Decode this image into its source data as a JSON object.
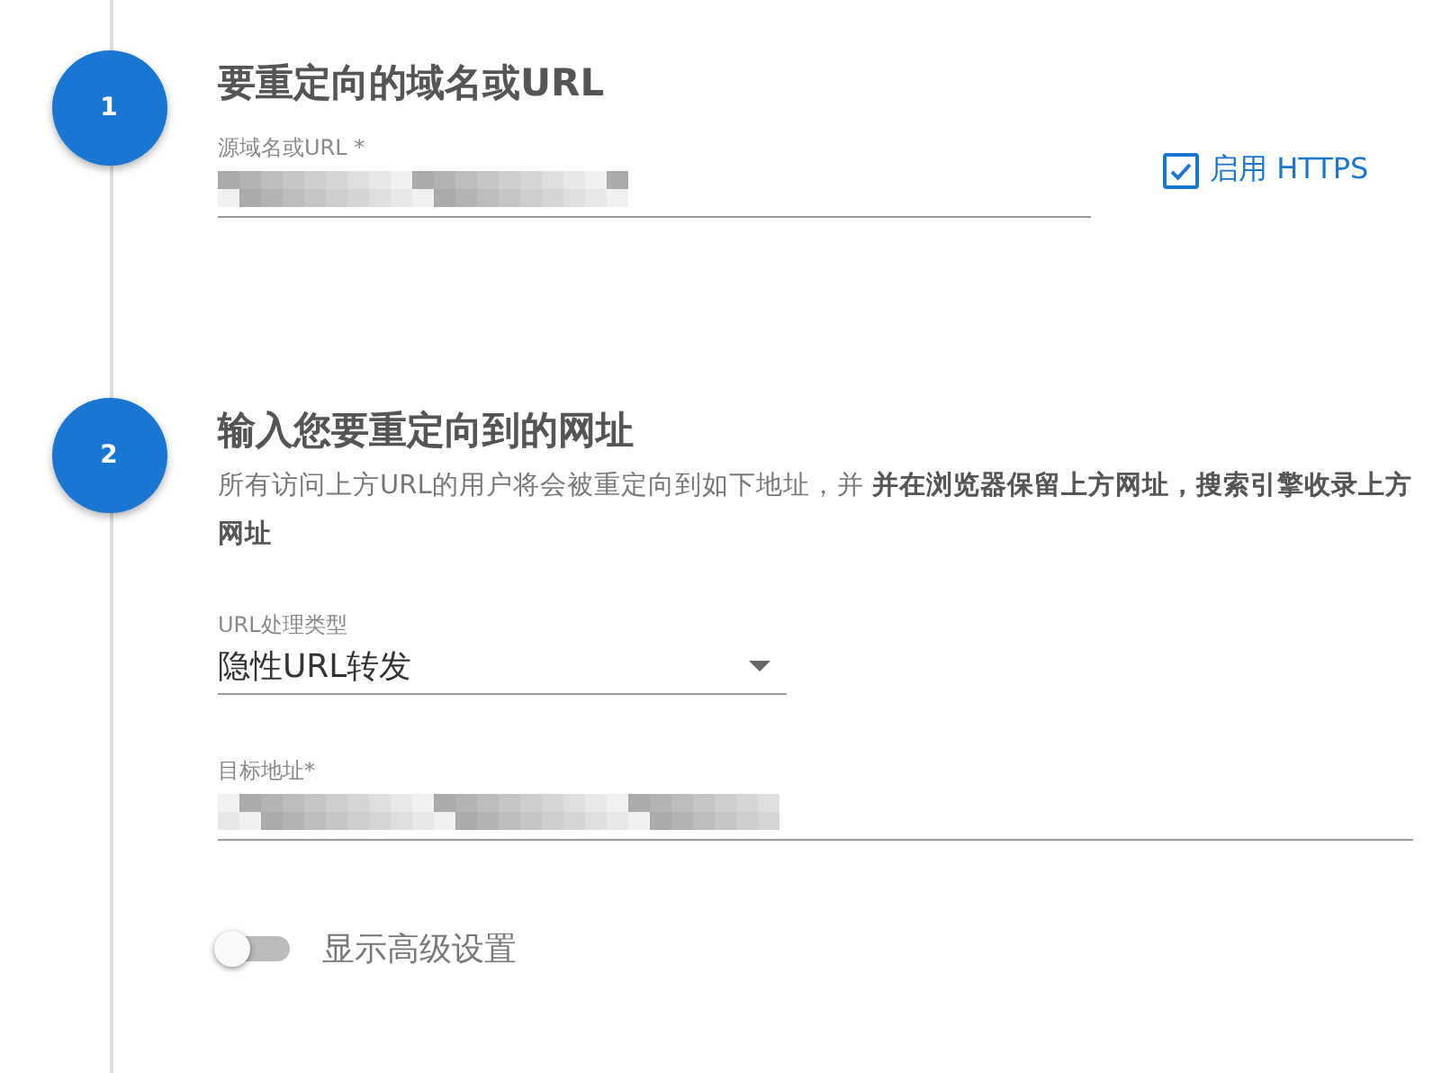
{
  "steps": [
    {
      "number": "1",
      "title": "要重定向的域名或URL",
      "fields": [
        {
          "kind": "text",
          "label": "源域名或URL *",
          "value_redacted": true
        }
      ],
      "https_option": {
        "label": "启用 HTTPS",
        "checked": true
      }
    },
    {
      "number": "2",
      "title": "输入您要重定向到的网址",
      "description": "所有访问上方URL的用户将会被重定向到如下地址，并 **并在浏览器保留上方网址，搜索引擎收录上方网址**",
      "fields": [
        {
          "kind": "select",
          "label": "URL处理类型",
          "value": "隐性URL转发"
        },
        {
          "kind": "text",
          "label": "目标地址*",
          "value_redacted": true
        }
      ]
    }
  ],
  "advanced_toggle": {
    "label": "显示高级设置",
    "on": false
  }
}
